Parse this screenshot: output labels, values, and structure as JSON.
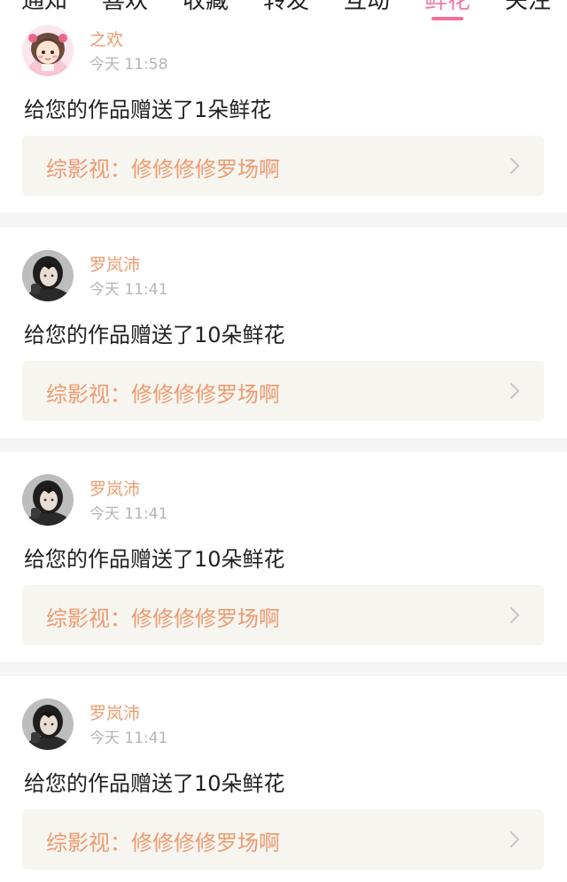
{
  "tabs": [
    {
      "label": "通知"
    },
    {
      "label": "喜欢"
    },
    {
      "label": "收藏"
    },
    {
      "label": "转发"
    },
    {
      "label": "互动"
    },
    {
      "label": "鲜花",
      "active": true
    },
    {
      "label": "关注"
    }
  ],
  "notifications": [
    {
      "username": "之欢",
      "time": "今天 11:58",
      "message": "给您的作品赠送了1朵鲜花",
      "work": "综影视：修修修修罗场啊",
      "avatar": "cartoon-girl-avatar"
    },
    {
      "username": "罗岚沛",
      "time": "今天 11:41",
      "message": "给您的作品赠送了10朵鲜花",
      "work": "综影视：修修修修罗场啊",
      "avatar": "photo-girl-avatar"
    },
    {
      "username": "罗岚沛",
      "time": "今天 11:41",
      "message": "给您的作品赠送了10朵鲜花",
      "work": "综影视：修修修修罗场啊",
      "avatar": "photo-girl-avatar"
    },
    {
      "username": "罗岚沛",
      "time": "今天 11:41",
      "message": "给您的作品赠送了10朵鲜花",
      "work": "综影视：修修修修罗场啊",
      "avatar": "photo-girl-avatar"
    }
  ],
  "colors": {
    "accent_pink": "#f0709a",
    "username_orange": "#ef9a6f",
    "work_box_bg": "#f6f5f0",
    "divider_gray": "#f5f5f5"
  }
}
